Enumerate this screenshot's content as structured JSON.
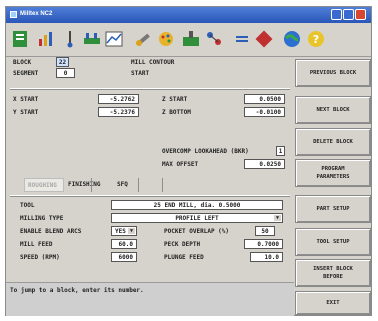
{
  "window": {
    "title": "Milltex NC2"
  },
  "header": {
    "block_label": "BLOCK",
    "block_value": "22",
    "segment_label": "SEGMENT",
    "segment_value": "0",
    "cycle_label": "MILL CONTOUR",
    "start_label": "START"
  },
  "coords": {
    "x_start_label": "X START",
    "x_start_value": "-5.2762",
    "y_start_label": "Y START",
    "y_start_value": "-5.2376",
    "z_start_label": "Z START",
    "z_start_value": "0.0500",
    "z_bottom_label": "Z BOTTOM",
    "z_bottom_value": "-0.0100",
    "overcomp_label": "OVERCOMP LOOKAHEAD (BKR)",
    "overcomp_value": "1",
    "max_offset_label": "MAX OFFSET",
    "max_offset_value": "0.0250"
  },
  "tabs": [
    {
      "label": "ROUGHING"
    },
    {
      "label": "FINISHING"
    },
    {
      "label": "SFQ"
    }
  ],
  "form": {
    "tool_label": "TOOL",
    "tool_value": "25 END MILL, dia. 0.5000",
    "milling_type_label": "MILLING TYPE",
    "milling_type_value": "PROFILE LEFT",
    "enable_blend_label": "ENABLE BLEND ARCS",
    "enable_blend_value": "YES",
    "pocket_overlap_label": "POCKET OVERLAP (%)",
    "pocket_overlap_value": "50",
    "mill_feed_label": "MILL FEED",
    "mill_feed_value": "60.0",
    "peck_depth_label": "PECK DEPTH",
    "peck_depth_value": "0.7000",
    "speed_label": "SPEED (RPM)",
    "speed_value": "6000",
    "plunge_feed_label": "PLUNGE FEED",
    "plunge_feed_value": "10.0"
  },
  "status": {
    "message": "To jump to a block, enter its number."
  },
  "sidebar": {
    "buttons": [
      "PREVIOUS BLOCK",
      "NEXT BLOCK",
      "DELETE BLOCK",
      "PROGRAM\nPARAMETERS",
      "PART SETUP",
      "TOOL SETUP",
      "INSERT BLOCK\nBEFORE",
      "EXIT"
    ]
  },
  "toolbar_icons": [
    "program-icon",
    "chart-icon",
    "probe-icon",
    "tools-icon",
    "graph-icon",
    "wrench-icon",
    "palette-icon",
    "mill-icon",
    "network-icon",
    "equals-icon",
    "component-icon",
    "globe-icon",
    "help-icon"
  ]
}
